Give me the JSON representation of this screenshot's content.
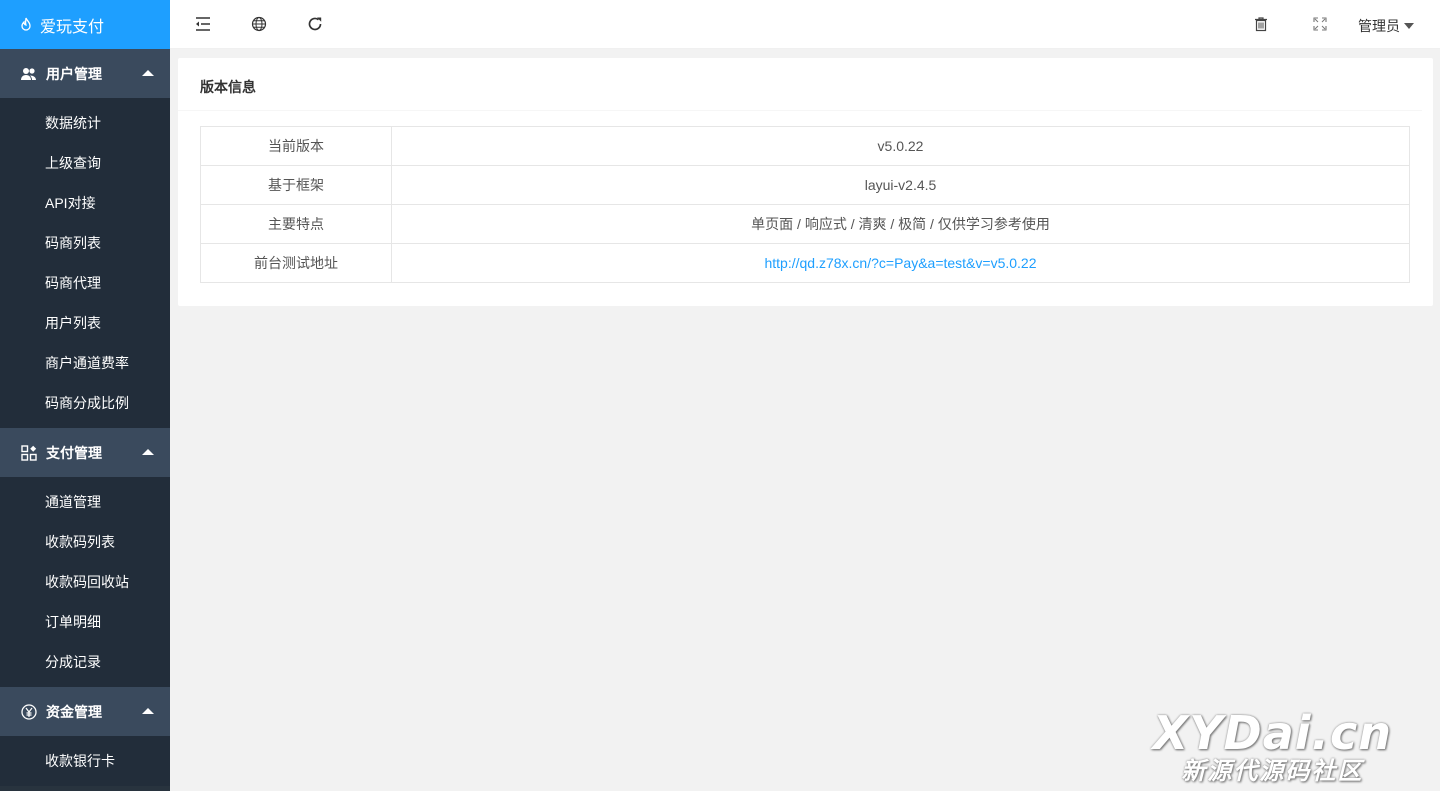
{
  "app": {
    "title": "爱玩支付",
    "logo_icon": "flame-icon"
  },
  "sidebar": {
    "groups": [
      {
        "label": "用户管理",
        "icon": "users-icon",
        "items": [
          "数据统计",
          "上级查询",
          "API对接",
          "码商列表",
          "码商代理",
          "用户列表",
          "商户通道费率",
          "码商分成比例"
        ]
      },
      {
        "label": "支付管理",
        "icon": "apps-icon",
        "items": [
          "通道管理",
          "收款码列表",
          "收款码回收站",
          "订单明细",
          "分成记录"
        ]
      },
      {
        "label": "资金管理",
        "icon": "yen-icon",
        "items": [
          "收款银行卡"
        ]
      }
    ]
  },
  "topbar": {
    "icons": [
      "menu-fold-icon",
      "globe-icon",
      "refresh-icon",
      "trash-icon",
      "fullscreen-icon"
    ],
    "user_label": "管理员"
  },
  "card": {
    "title": "版本信息",
    "rows": [
      {
        "key": "当前版本",
        "value": "v5.0.22"
      },
      {
        "key": "基于框架",
        "value": "layui-v2.4.5"
      },
      {
        "key": "主要特点",
        "value": "单页面 / 响应式 / 清爽 / 极简 / 仅供学习参考使用"
      },
      {
        "key": "前台测试地址",
        "value": "http://qd.z78x.cn/?c=Pay&a=test&v=v5.0.22"
      }
    ]
  },
  "watermark": {
    "line1": "XYDai.cn",
    "line2": "新源代源码社区"
  },
  "colors": {
    "brand": "#1e9fff",
    "sidebar": "#28333e",
    "sidebar_group": "#3a4a5d",
    "link": "#1e9fff"
  }
}
